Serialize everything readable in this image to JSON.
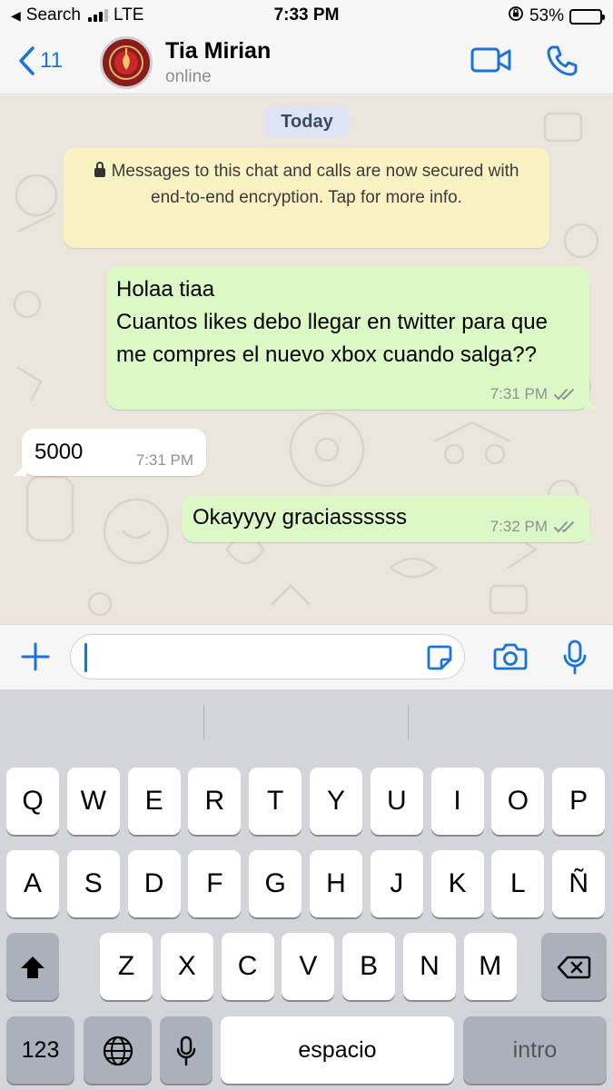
{
  "status_bar": {
    "back_app": "Search",
    "network": "LTE",
    "time": "7:33 PM",
    "battery": "53%",
    "battery_level": 0.53,
    "signal_bars": 3
  },
  "header": {
    "back_count": "11",
    "contact_name": "Tia Mirian",
    "contact_status": "online"
  },
  "chat": {
    "date_label": "Today",
    "system_message": "Messages to this chat and calls are now secured with end-to-end encryption. Tap for more info.",
    "messages": [
      {
        "direction": "outgoing",
        "text": "Holaa tiaa\nCuantos likes debo llegar en twitter para que me compres el nuevo xbox cuando salga??",
        "time": "7:31 PM",
        "status": "read"
      },
      {
        "direction": "incoming",
        "text": "5000",
        "time": "7:31 PM"
      },
      {
        "direction": "outgoing",
        "text": "Okayyyy graciassssss",
        "time": "7:32 PM",
        "status": "read"
      }
    ]
  },
  "input": {
    "value": ""
  },
  "keyboard": {
    "row1": [
      "Q",
      "W",
      "E",
      "R",
      "T",
      "Y",
      "U",
      "I",
      "O",
      "P"
    ],
    "row2": [
      "A",
      "S",
      "D",
      "F",
      "G",
      "H",
      "J",
      "K",
      "L",
      "Ñ"
    ],
    "row3": [
      "Z",
      "X",
      "C",
      "V",
      "B",
      "N",
      "M"
    ],
    "numbers_key": "123",
    "space_key": "espacio",
    "return_key": "intro"
  },
  "colors": {
    "accent": "#1a73d9",
    "outgoing_bubble": "#dcf8c6",
    "incoming_bubble": "#ffffff",
    "system_bubble": "#fbf2c4",
    "chat_background": "#ece5dd",
    "keyboard_background": "#d3d5db"
  },
  "icons": [
    "back-chevron-icon",
    "video-call-icon",
    "phone-icon",
    "lock-icon",
    "double-check-icon",
    "plus-icon",
    "sticker-icon",
    "camera-icon",
    "microphone-icon",
    "shift-icon",
    "backspace-icon",
    "globe-icon"
  ]
}
